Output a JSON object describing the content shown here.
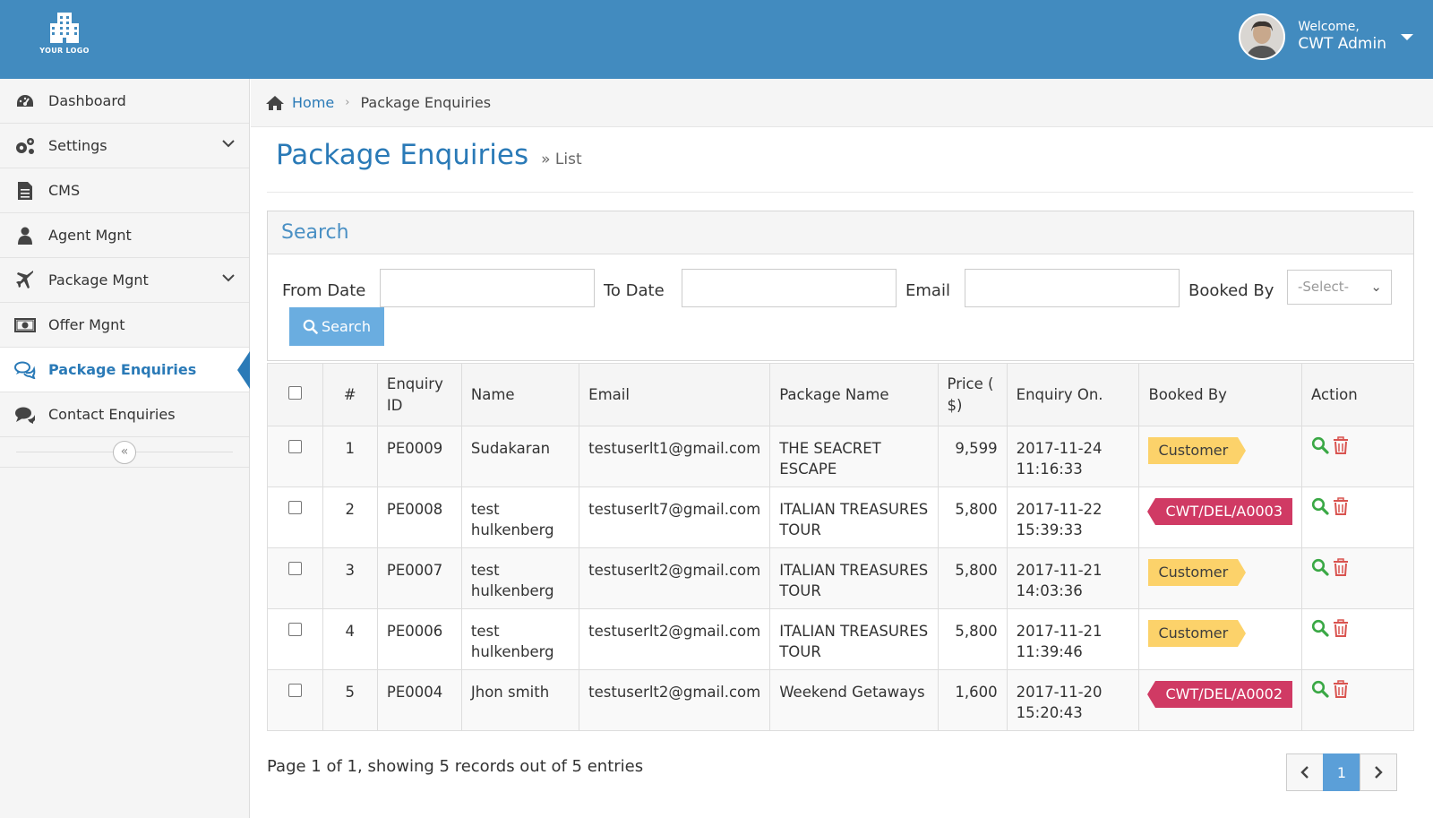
{
  "header": {
    "logo_text": "YOUR LOGO",
    "welcome": "Welcome,",
    "user_name": "CWT Admin"
  },
  "sidebar": {
    "items": [
      {
        "label": "Dashboard",
        "icon": "dashboard-icon"
      },
      {
        "label": "Settings",
        "icon": "gears-icon"
      },
      {
        "label": "CMS",
        "icon": "file-icon"
      },
      {
        "label": "Agent Mgnt",
        "icon": "user-icon"
      },
      {
        "label": "Package Mgnt",
        "icon": "plane-icon"
      },
      {
        "label": "Offer Mgnt",
        "icon": "money-icon"
      },
      {
        "label": "Package Enquiries",
        "icon": "comments-icon"
      },
      {
        "label": "Contact Enquiries",
        "icon": "comment-icon"
      }
    ],
    "collapse_symbol": "«"
  },
  "breadcrumb": {
    "home": "Home",
    "current": "Package Enquiries"
  },
  "page": {
    "title": "Package Enquiries",
    "subtitle": "» List"
  },
  "search": {
    "heading": "Search",
    "from_date_label": "From Date",
    "from_date_value": "",
    "to_date_label": "To Date",
    "to_date_value": "",
    "email_label": "Email",
    "email_value": "",
    "booked_by_label": "Booked By",
    "booked_by_selected": "-Select-",
    "button_label": "Search"
  },
  "table": {
    "headers": {
      "num": "#",
      "enquiry_id": "Enquiry ID",
      "name": "Name",
      "email": "Email",
      "package_name": "Package Name",
      "price": "Price ( $)",
      "enquiry_on": "Enquiry On.",
      "booked_by": "Booked By",
      "action": "Action"
    },
    "rows": [
      {
        "num": "1",
        "id": "PE0009",
        "name": "Sudakaran",
        "email": "testuserlt1@gmail.com",
        "package": "THE SEACRET ESCAPE",
        "price": "9,599",
        "date": "2017-11-24",
        "time": "11:16:33",
        "booked_by": "Customer"
      },
      {
        "num": "2",
        "id": "PE0008",
        "name": "test hulkenberg",
        "email": "testuserlt7@gmail.com",
        "package": "ITALIAN TREASURES TOUR",
        "price": "5,800",
        "date": "2017-11-22",
        "time": "15:39:33",
        "booked_by": "CWT/DEL/A0003"
      },
      {
        "num": "3",
        "id": "PE0007",
        "name": "test hulkenberg",
        "email": "testuserlt2@gmail.com",
        "package": "ITALIAN TREASURES TOUR",
        "price": "5,800",
        "date": "2017-11-21",
        "time": "14:03:36",
        "booked_by": "Customer"
      },
      {
        "num": "4",
        "id": "PE0006",
        "name": "test hulkenberg",
        "email": "testuserlt2@gmail.com",
        "package": "ITALIAN TREASURES TOUR",
        "price": "5,800",
        "date": "2017-11-21",
        "time": "11:39:46",
        "booked_by": "Customer"
      },
      {
        "num": "5",
        "id": "PE0004",
        "name": "Jhon smith",
        "email": "testuserlt2@gmail.com",
        "package": "Weekend Getaways",
        "price": "1,600",
        "date": "2017-11-20",
        "time": "15:20:43",
        "booked_by": "CWT/DEL/A0002"
      }
    ]
  },
  "footer": {
    "summary": "Page 1 of 1, showing 5 records out of 5 entries",
    "current_page": "1"
  },
  "colors": {
    "header": "#428bbf",
    "accent": "#2a7ab7",
    "customer_tag": "#fcd26a",
    "agent_tag": "#d03a64",
    "view_icon": "#3aa845",
    "delete_icon": "#d9534f"
  }
}
